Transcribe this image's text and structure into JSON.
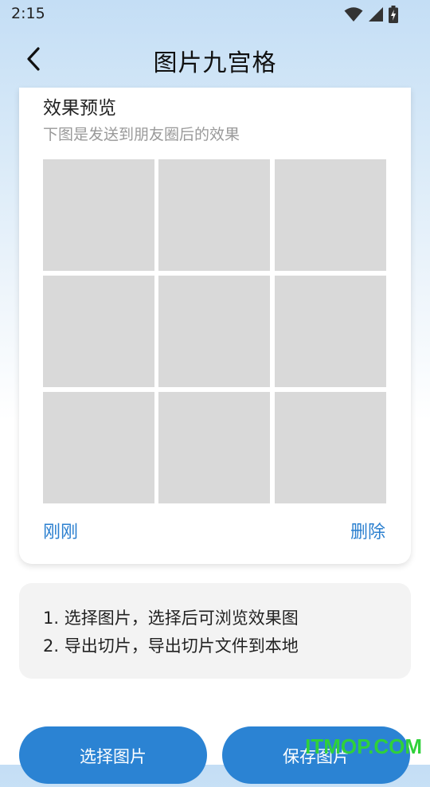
{
  "status_bar": {
    "time": "2:15",
    "icons": [
      "wifi-icon",
      "cellular-signal-icon",
      "battery-charging-icon"
    ]
  },
  "header": {
    "title": "图片九宫格",
    "back_icon": "chevron-left-icon"
  },
  "preview_card": {
    "title": "效果预览",
    "subtitle": "下图是发送到朋友圈后的效果",
    "grid_cells": 9,
    "time_text": "刚刚",
    "delete_label": "删除",
    "link_color": "#2a7fcf"
  },
  "instructions": {
    "lines": [
      "1. 选择图片，选择后可浏览效果图",
      "2. 导出切片，导出切片文件到本地"
    ]
  },
  "actions": {
    "select_label": "选择图片",
    "save_label": "保存图片",
    "button_color": "#2b83d3"
  },
  "watermark": {
    "text": "ITMOP.COM",
    "color": "#2fd13a"
  }
}
